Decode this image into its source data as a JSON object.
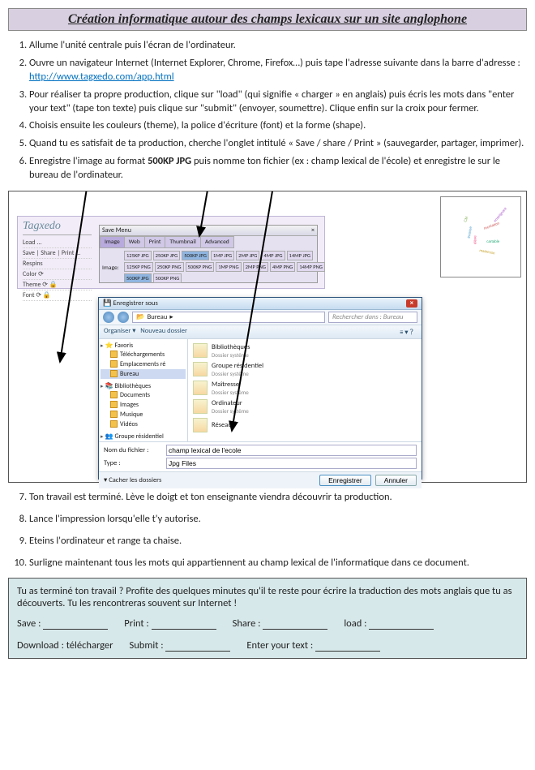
{
  "title": "Création informatique autour des champs lexicaux sur un site anglophone",
  "steps_a": [
    "Allume l'unité centrale puis l'écran de l'ordinateur.",
    {
      "pre": "Ouvre un navigateur Internet (Internet Explorer, Chrome, Firefox…) puis tape l'adresse suivante dans la barre d'adresse : ",
      "link": "http://www.tagxedo.com/app.html"
    },
    "Pour réaliser ta propre production, clique sur \"load\" (qui signifie « charger » en anglais) puis écris les mots dans \"enter your text\" (tape ton texte) puis clique sur \"submit\" (envoyer, soumettre). Clique enfin sur la croix pour fermer.",
    "Choisis ensuite les couleurs (theme), la police d'écriture (font) et la forme (shape).",
    "Quand tu es satisfait de ta production, cherche l'onglet intitulé « Save / share / Print » (sauvegarder, partager, imprimer).",
    {
      "pre": "Enregistre l'image au format ",
      "bold": "500KP JPG",
      "post": " puis nomme ton fichier (ex : champ lexical de l'école) et enregistre le sur le bureau de l'ordinateur."
    }
  ],
  "tagxedo": {
    "logo": "Tagxedo",
    "menu": [
      "Load ...",
      "Save | Share | Print ...",
      "Respins",
      "Color ⟳",
      "Theme ⟳ 🔒",
      "Font ⟳ 🔒"
    ]
  },
  "save_menu": {
    "title": "Save Menu",
    "close": "×",
    "tabs": [
      "Image",
      "Web",
      "Print",
      "Thumbnail",
      "Advanced"
    ],
    "image_label": "Image:",
    "rows": [
      [
        "125KP JPG",
        "250KP JPG",
        "500KP JPG",
        "1MP JPG",
        "2MP JPG",
        "4MP JPG",
        "14MP JPG"
      ],
      [
        "125KP PNG",
        "250KP PNG",
        "500KP PNG",
        "1MP PNG",
        "2MP PNG",
        "4MP PNG",
        "14MP PNG"
      ],
      [
        "500KP JPG",
        "500KP PNG"
      ]
    ],
    "selected": "500KP JPG"
  },
  "win": {
    "title": "Enregistrer sous",
    "close": "×",
    "breadcrumb": [
      "Bureau",
      "▸"
    ],
    "search_ph": "Rechercher dans : Bureau",
    "toolbar": {
      "org": "Organiser ▾",
      "new": "Nouveau dossier",
      "icons": "≡ ▾  ？"
    },
    "tree": {
      "fav_h": "Favoris",
      "fav": [
        "Téléchargements",
        "Emplacements ré",
        "Bureau"
      ],
      "lib_h": "Bibliothèques",
      "lib": [
        "Documents",
        "Images",
        "Musique",
        "Vidéos"
      ],
      "grp_h": "Groupe résidentiel"
    },
    "list": [
      {
        "n": "Bibliothèques",
        "m": "Dossier système"
      },
      {
        "n": "Groupe résidentiel",
        "m": "Dossier système"
      },
      {
        "n": "Maîtresse",
        "m": "Dossier système"
      },
      {
        "n": "Ordinateur",
        "m": "Dossier système"
      },
      {
        "n": "Réseau",
        "m": ""
      }
    ],
    "fname_lbl": "Nom du fichier :",
    "fname_val": "champ lexical de l'ecole",
    "ftype_lbl": "Type :",
    "ftype_val": "Jpg Files",
    "hide": "Cacher les dossiers",
    "save_btn": "Enregistrer",
    "cancel_btn": "Annuler"
  },
  "steps_b": [
    "Ton travail est terminé. Lève le doigt et ton enseignante viendra découvrir ta production.",
    "Lance l'impression lorsqu'elle t'y autorise.",
    "Eteins l'ordinateur et range ta chaise.",
    "Surligne maintenant tous les mots qui appartiennent au champ lexical de l'informatique dans ce document."
  ],
  "bonus": {
    "intro": "Tu as terminé ton travail ? Profite des quelques minutes qu'il te reste pour écrire la traduction des mots anglais que tu as découverts. Tu les rencontreras souvent sur Internet !",
    "row1": [
      {
        "k": "Save :",
        "v": ""
      },
      {
        "k": "Print :",
        "v": ""
      },
      {
        "k": "Share :",
        "v": ""
      },
      {
        "k": "load :",
        "v": ""
      }
    ],
    "row2": [
      {
        "k": "Download :",
        "v": "télécharger"
      },
      {
        "k": "Submit :",
        "v": ""
      },
      {
        "k": "Enter your text :",
        "v": ""
      }
    ]
  }
}
